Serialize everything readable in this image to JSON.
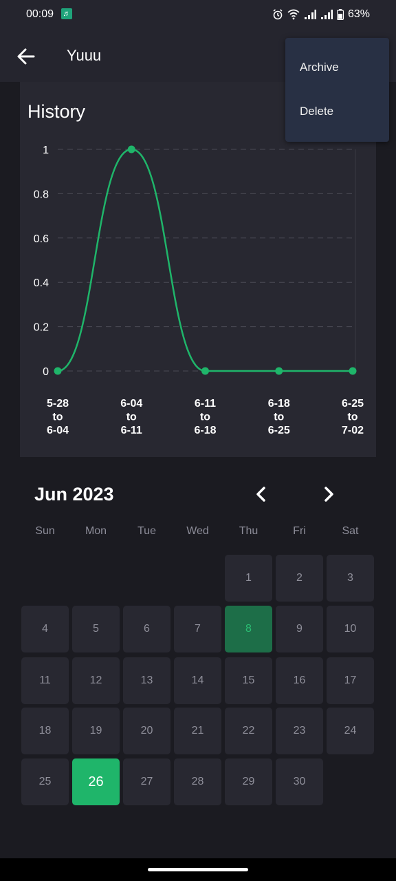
{
  "status_bar": {
    "time": "00:09",
    "battery": "63%"
  },
  "app_bar": {
    "title": "Yuuu"
  },
  "menu": {
    "archive": "Archive",
    "delete": "Delete"
  },
  "history": {
    "title": "History"
  },
  "colors": {
    "accent": "#1fb56a",
    "highlight": "#1d6e48",
    "card": "#282831",
    "background": "#1b1b21",
    "menu": "#283044"
  },
  "chart_data": {
    "type": "line",
    "title": "History",
    "categories": [
      "5-28\nto\n6-04",
      "6-04\nto\n6-11",
      "6-11\nto\n6-18",
      "6-18\nto\n6-25",
      "6-25\nto\n7-02"
    ],
    "series": [
      {
        "values": [
          0,
          1,
          0,
          0,
          0
        ],
        "color": "#1fb56a"
      }
    ],
    "y_ticks": [
      "0",
      "0.2",
      "0.4",
      "0.6",
      "0.8",
      "1"
    ],
    "ylim": [
      0,
      1
    ],
    "grid": "dashed-horizontal",
    "smooth": true
  },
  "calendar": {
    "month_label": "Jun 2023",
    "weekdays": [
      "Sun",
      "Mon",
      "Tue",
      "Wed",
      "Thu",
      "Fri",
      "Sat"
    ],
    "first_weekday_index": 4,
    "days": [
      "1",
      "2",
      "3",
      "4",
      "5",
      "6",
      "7",
      "8",
      "9",
      "10",
      "11",
      "12",
      "13",
      "14",
      "15",
      "16",
      "17",
      "18",
      "19",
      "20",
      "21",
      "22",
      "23",
      "24",
      "25",
      "26",
      "27",
      "28",
      "29",
      "30"
    ],
    "highlighted_day": "8",
    "selected_day": "26"
  }
}
